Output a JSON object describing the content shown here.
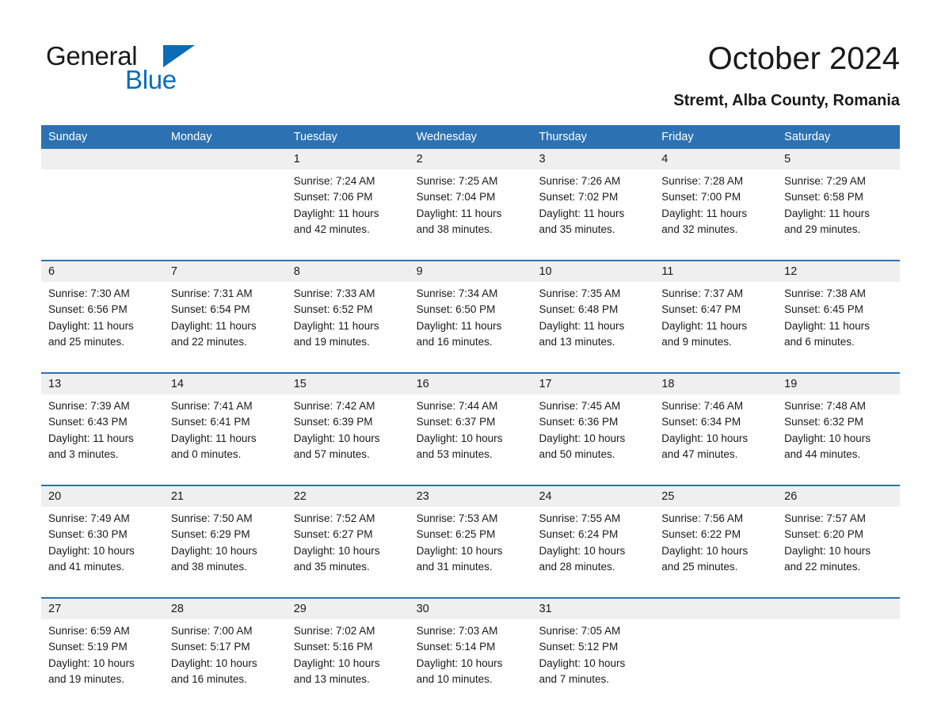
{
  "brand": {
    "name_part1": "General",
    "name_part2": "Blue",
    "accent_color": "#0b6cb8"
  },
  "header": {
    "title": "October 2024",
    "subtitle": "Stremt, Alba County, Romania"
  },
  "theme": {
    "header_blue": "#2c72b3",
    "date_band_gray": "#efefef"
  },
  "weekdays": [
    "Sunday",
    "Monday",
    "Tuesday",
    "Wednesday",
    "Thursday",
    "Friday",
    "Saturday"
  ],
  "weeks": [
    [
      {
        "date": "",
        "lines": []
      },
      {
        "date": "",
        "lines": []
      },
      {
        "date": "1",
        "lines": [
          "Sunrise: 7:24 AM",
          "Sunset: 7:06 PM",
          "Daylight: 11 hours",
          "and 42 minutes."
        ]
      },
      {
        "date": "2",
        "lines": [
          "Sunrise: 7:25 AM",
          "Sunset: 7:04 PM",
          "Daylight: 11 hours",
          "and 38 minutes."
        ]
      },
      {
        "date": "3",
        "lines": [
          "Sunrise: 7:26 AM",
          "Sunset: 7:02 PM",
          "Daylight: 11 hours",
          "and 35 minutes."
        ]
      },
      {
        "date": "4",
        "lines": [
          "Sunrise: 7:28 AM",
          "Sunset: 7:00 PM",
          "Daylight: 11 hours",
          "and 32 minutes."
        ]
      },
      {
        "date": "5",
        "lines": [
          "Sunrise: 7:29 AM",
          "Sunset: 6:58 PM",
          "Daylight: 11 hours",
          "and 29 minutes."
        ]
      }
    ],
    [
      {
        "date": "6",
        "lines": [
          "Sunrise: 7:30 AM",
          "Sunset: 6:56 PM",
          "Daylight: 11 hours",
          "and 25 minutes."
        ]
      },
      {
        "date": "7",
        "lines": [
          "Sunrise: 7:31 AM",
          "Sunset: 6:54 PM",
          "Daylight: 11 hours",
          "and 22 minutes."
        ]
      },
      {
        "date": "8",
        "lines": [
          "Sunrise: 7:33 AM",
          "Sunset: 6:52 PM",
          "Daylight: 11 hours",
          "and 19 minutes."
        ]
      },
      {
        "date": "9",
        "lines": [
          "Sunrise: 7:34 AM",
          "Sunset: 6:50 PM",
          "Daylight: 11 hours",
          "and 16 minutes."
        ]
      },
      {
        "date": "10",
        "lines": [
          "Sunrise: 7:35 AM",
          "Sunset: 6:48 PM",
          "Daylight: 11 hours",
          "and 13 minutes."
        ]
      },
      {
        "date": "11",
        "lines": [
          "Sunrise: 7:37 AM",
          "Sunset: 6:47 PM",
          "Daylight: 11 hours",
          "and 9 minutes."
        ]
      },
      {
        "date": "12",
        "lines": [
          "Sunrise: 7:38 AM",
          "Sunset: 6:45 PM",
          "Daylight: 11 hours",
          "and 6 minutes."
        ]
      }
    ],
    [
      {
        "date": "13",
        "lines": [
          "Sunrise: 7:39 AM",
          "Sunset: 6:43 PM",
          "Daylight: 11 hours",
          "and 3 minutes."
        ]
      },
      {
        "date": "14",
        "lines": [
          "Sunrise: 7:41 AM",
          "Sunset: 6:41 PM",
          "Daylight: 11 hours",
          "and 0 minutes."
        ]
      },
      {
        "date": "15",
        "lines": [
          "Sunrise: 7:42 AM",
          "Sunset: 6:39 PM",
          "Daylight: 10 hours",
          "and 57 minutes."
        ]
      },
      {
        "date": "16",
        "lines": [
          "Sunrise: 7:44 AM",
          "Sunset: 6:37 PM",
          "Daylight: 10 hours",
          "and 53 minutes."
        ]
      },
      {
        "date": "17",
        "lines": [
          "Sunrise: 7:45 AM",
          "Sunset: 6:36 PM",
          "Daylight: 10 hours",
          "and 50 minutes."
        ]
      },
      {
        "date": "18",
        "lines": [
          "Sunrise: 7:46 AM",
          "Sunset: 6:34 PM",
          "Daylight: 10 hours",
          "and 47 minutes."
        ]
      },
      {
        "date": "19",
        "lines": [
          "Sunrise: 7:48 AM",
          "Sunset: 6:32 PM",
          "Daylight: 10 hours",
          "and 44 minutes."
        ]
      }
    ],
    [
      {
        "date": "20",
        "lines": [
          "Sunrise: 7:49 AM",
          "Sunset: 6:30 PM",
          "Daylight: 10 hours",
          "and 41 minutes."
        ]
      },
      {
        "date": "21",
        "lines": [
          "Sunrise: 7:50 AM",
          "Sunset: 6:29 PM",
          "Daylight: 10 hours",
          "and 38 minutes."
        ]
      },
      {
        "date": "22",
        "lines": [
          "Sunrise: 7:52 AM",
          "Sunset: 6:27 PM",
          "Daylight: 10 hours",
          "and 35 minutes."
        ]
      },
      {
        "date": "23",
        "lines": [
          "Sunrise: 7:53 AM",
          "Sunset: 6:25 PM",
          "Daylight: 10 hours",
          "and 31 minutes."
        ]
      },
      {
        "date": "24",
        "lines": [
          "Sunrise: 7:55 AM",
          "Sunset: 6:24 PM",
          "Daylight: 10 hours",
          "and 28 minutes."
        ]
      },
      {
        "date": "25",
        "lines": [
          "Sunrise: 7:56 AM",
          "Sunset: 6:22 PM",
          "Daylight: 10 hours",
          "and 25 minutes."
        ]
      },
      {
        "date": "26",
        "lines": [
          "Sunrise: 7:57 AM",
          "Sunset: 6:20 PM",
          "Daylight: 10 hours",
          "and 22 minutes."
        ]
      }
    ],
    [
      {
        "date": "27",
        "lines": [
          "Sunrise: 6:59 AM",
          "Sunset: 5:19 PM",
          "Daylight: 10 hours",
          "and 19 minutes."
        ]
      },
      {
        "date": "28",
        "lines": [
          "Sunrise: 7:00 AM",
          "Sunset: 5:17 PM",
          "Daylight: 10 hours",
          "and 16 minutes."
        ]
      },
      {
        "date": "29",
        "lines": [
          "Sunrise: 7:02 AM",
          "Sunset: 5:16 PM",
          "Daylight: 10 hours",
          "and 13 minutes."
        ]
      },
      {
        "date": "30",
        "lines": [
          "Sunrise: 7:03 AM",
          "Sunset: 5:14 PM",
          "Daylight: 10 hours",
          "and 10 minutes."
        ]
      },
      {
        "date": "31",
        "lines": [
          "Sunrise: 7:05 AM",
          "Sunset: 5:12 PM",
          "Daylight: 10 hours",
          "and 7 minutes."
        ]
      },
      {
        "date": "",
        "lines": []
      },
      {
        "date": "",
        "lines": []
      }
    ]
  ]
}
